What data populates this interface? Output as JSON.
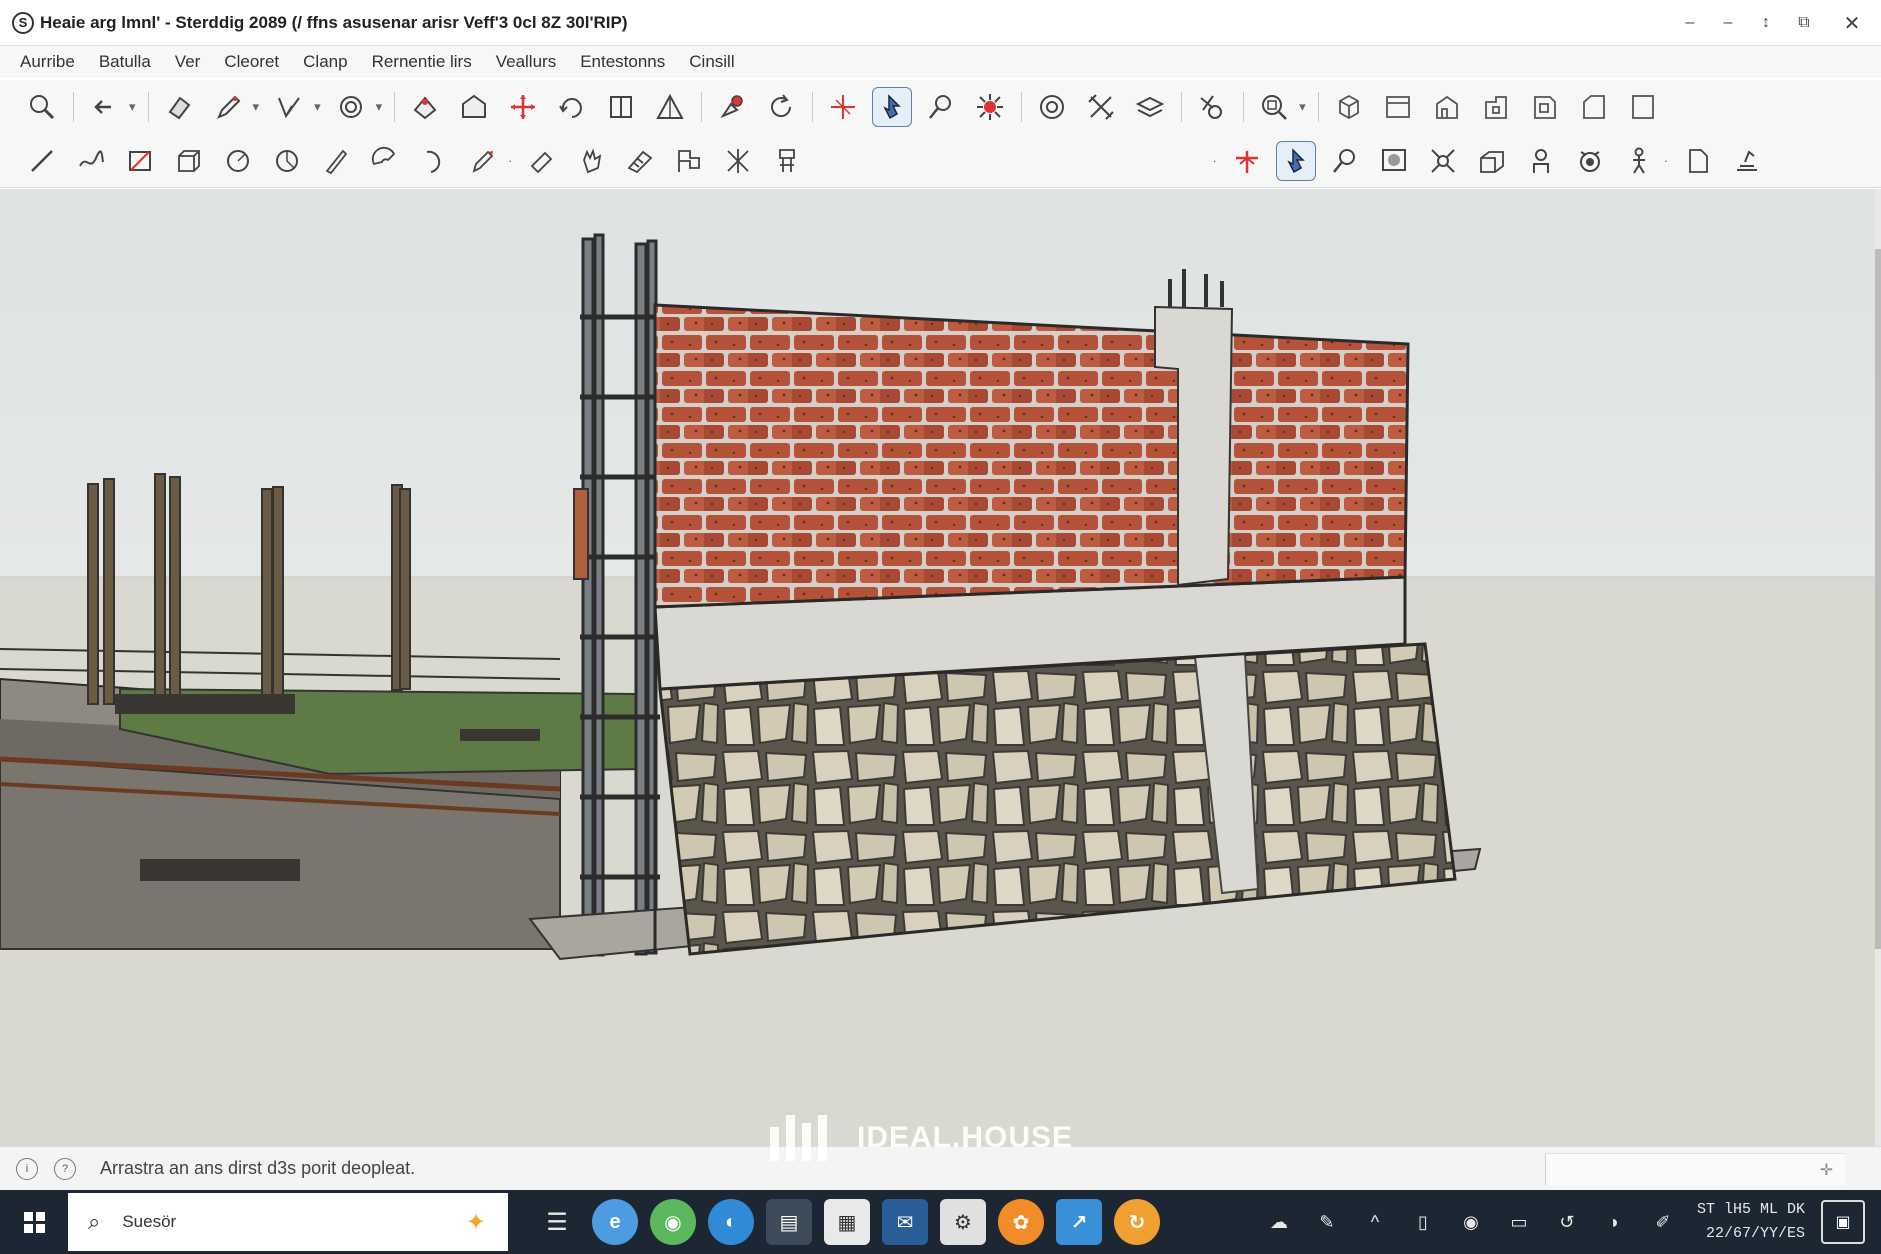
{
  "window": {
    "title": "Heaie arg lmnl' - Sterddig 2089 (/ ffns asusenar arisr Veff'3 0cl 8Z 30l'RIP)",
    "controls": [
      "–",
      "–",
      "↕",
      "⧉",
      "✕"
    ]
  },
  "menu": {
    "items": [
      "Aurribe",
      "Batulla",
      "Ver",
      "Cleoret",
      "Clanp",
      "Rernentie lirs",
      "Veallurs",
      "Entestonns",
      "Cinsill"
    ]
  },
  "statusbar": {
    "hint": "Arrastra an ans dirst d3s porit deopleat.",
    "measure_icon": "✛"
  },
  "watermark": {
    "text": "IDEAL.HOUSE"
  },
  "taskbar": {
    "search_text": "Suesör",
    "clock_time": "ST lH5 ML DK",
    "clock_date": "22/67/YY/ES"
  },
  "theme": {
    "accent": "#5c7fb0",
    "taskbar_bg": "#1d2733",
    "brick": "#b4533a",
    "mortar": "#d7d3cc",
    "sky": "#e9ebe8",
    "ground": "#d8d8cc"
  },
  "icons": {
    "toolbar1": [
      "zoom-icon",
      "arrow-icon",
      "eraser-icon",
      "pencil-icon",
      "path-icon",
      "rotate-icon",
      "follow-icon",
      "warehouse-icon",
      "move-icon",
      "orbit-icon",
      "section-icon",
      "triangle-icon",
      "paint-icon",
      "refresh-icon",
      "axes-icon",
      "select-icon",
      "search-icon",
      "explode-icon",
      "target-icon",
      "scale-icon",
      "layers-icon",
      "gear-icon",
      "zoom-extents-icon",
      "iso-view-icon",
      "top-view-icon",
      "front-view-icon",
      "right-view-icon",
      "back-view-icon",
      "left-view-icon",
      "frame-icon"
    ],
    "toolbar2": [
      "line-icon",
      "freehand-icon",
      "rectangle-icon",
      "push-pull-icon",
      "circle-icon",
      "polygon-icon",
      "arc-icon",
      "pie-icon",
      "offset-icon",
      "tape-icon",
      "text-icon",
      "hand-icon",
      "dimension-icon",
      "flag-icon",
      "star-icon",
      "stair-icon",
      "axes-red-icon",
      "select-active-icon",
      "search2-icon",
      "window-icon",
      "explode2-icon",
      "component-icon",
      "person-icon",
      "camera-icon",
      "walk-icon",
      "page-icon",
      "sun-icon"
    ]
  }
}
